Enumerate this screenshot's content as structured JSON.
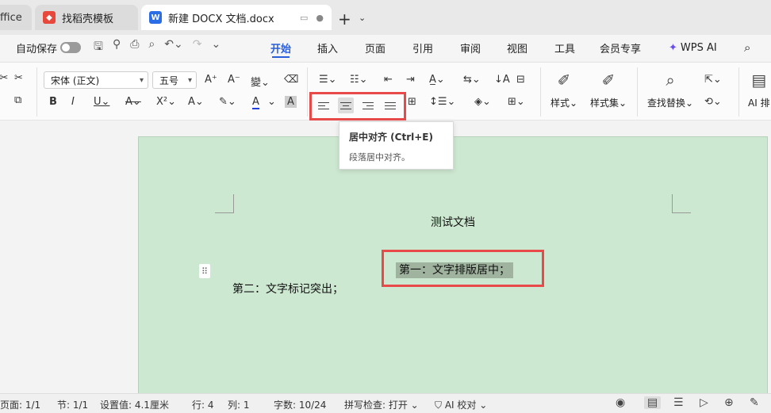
{
  "tabs": [
    {
      "label": "ffice"
    },
    {
      "label": "找稻壳模板"
    },
    {
      "label": "新建 DOCX 文档.docx"
    }
  ],
  "menubar": {
    "autosave_label": "自动保存",
    "items": [
      "开始",
      "插入",
      "页面",
      "引用",
      "审阅",
      "视图",
      "工具",
      "会员专享",
      "WPS AI"
    ],
    "active": "开始"
  },
  "ribbon": {
    "font_name": "宋体 (正文)",
    "font_size": "五号",
    "style_label": "样式",
    "style_set_label": "样式集",
    "find_replace_label": "查找替换",
    "ai_label": "AI 排"
  },
  "tooltip": {
    "title": "居中对齐 (Ctrl+E)",
    "desc": "段落居中对齐。"
  },
  "document": {
    "title": "测试文档",
    "para1": "第一：文字排版居中；",
    "para2": "第二：文字标记突出；"
  },
  "statusbar": {
    "page": "页面: 1/1",
    "section": "节: 1/1",
    "setting": "设置值: 4.1厘米",
    "row": "行: 4",
    "col": "列: 1",
    "words": "字数: 10/24",
    "spell": "拼写检查: 打开",
    "ai_check": "AI 校对"
  },
  "colors": {
    "page_bg": "#cde8d1",
    "accent": "#2b5fd9",
    "highlight_box": "#e84a4a",
    "text_highlight": "#9fb39f"
  }
}
